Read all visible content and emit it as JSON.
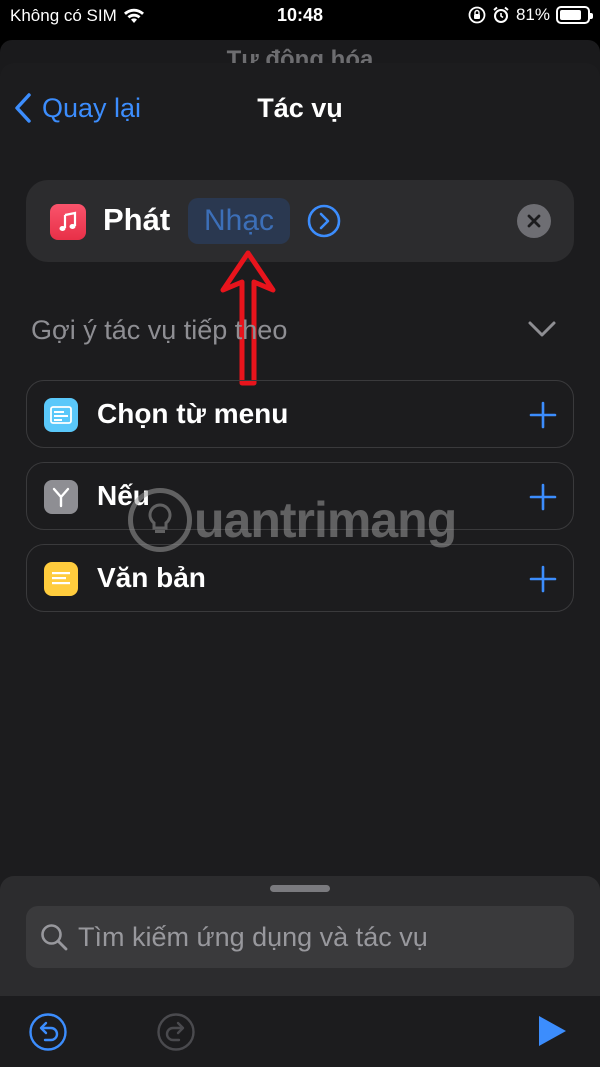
{
  "status_bar": {
    "carrier": "Không có SIM",
    "time": "10:48",
    "battery_percent": "81%",
    "battery_level": 0.81
  },
  "background": {
    "title": "Tự động hóa"
  },
  "nav": {
    "back_label": "Quay lại",
    "title": "Tác vụ"
  },
  "action": {
    "app_icon": "music-icon",
    "verb": "Phát",
    "parameter": "Nhạc"
  },
  "suggestions": {
    "header": "Gợi ý tác vụ tiếp theo",
    "items": [
      {
        "label": "Chọn từ menu",
        "icon": "menu-icon",
        "color": "#5ac8fa"
      },
      {
        "label": "Nếu",
        "icon": "branch-icon",
        "color": "#8e8e93"
      },
      {
        "label": "Văn bản",
        "icon": "text-icon",
        "color": "#ffcc3d"
      }
    ]
  },
  "search": {
    "placeholder": "Tìm kiếm ứng dụng và tác vụ"
  },
  "watermark": {
    "text": "uantrimang"
  },
  "colors": {
    "accent": "#3c8dfd",
    "sheet_bg": "#1c1c1e",
    "card_bg": "#2c2c2e",
    "annotation": "#e8141c"
  }
}
